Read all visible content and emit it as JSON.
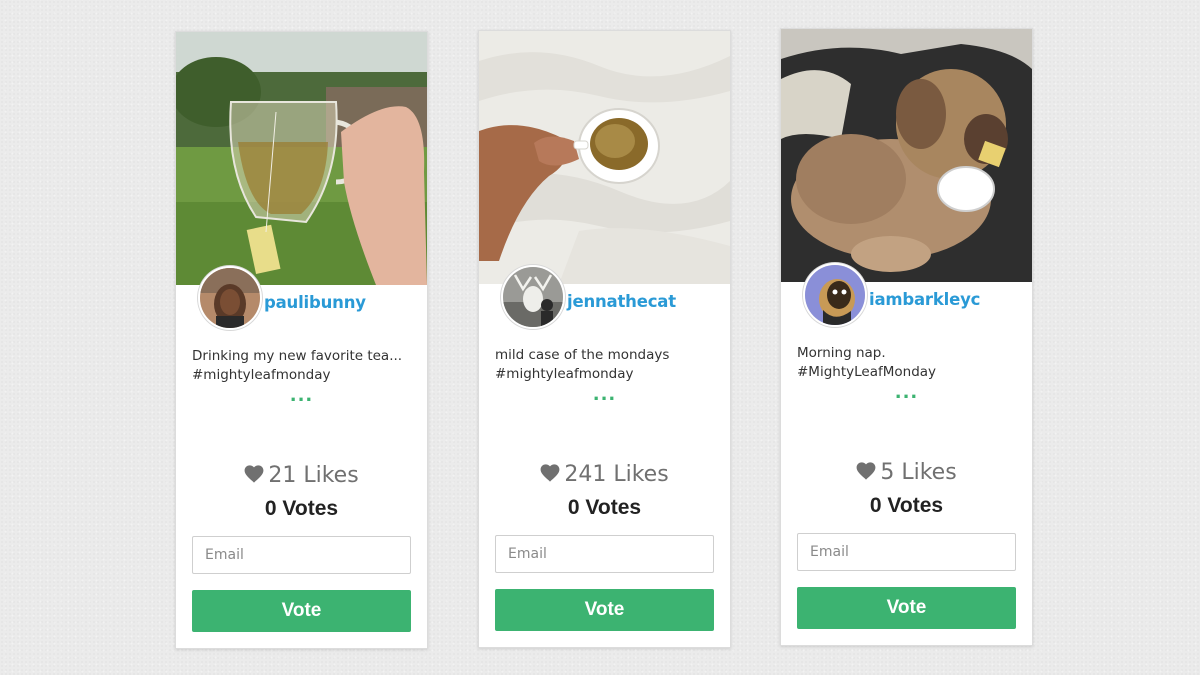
{
  "colors": {
    "accent_green": "#3cb371",
    "username_blue": "#2a9ad6",
    "likes_gray": "#707070",
    "page_background": "#ebebeb"
  },
  "cards": [
    {
      "username": "paulibunny",
      "caption_line1": "Drinking my new favorite tea...",
      "caption_line2": "#mightyleafmonday",
      "more": "...",
      "likes": "21 Likes",
      "votes": "0 Votes",
      "email_placeholder": "Email",
      "vote_label": "Vote",
      "heart_icon": "heart-icon"
    },
    {
      "username": "jennathecat",
      "caption_line1": "mild case of the mondays",
      "caption_line2": "#mightyleafmonday",
      "more": "...",
      "likes": "241 Likes",
      "votes": "0 Votes",
      "email_placeholder": "Email",
      "vote_label": "Vote",
      "heart_icon": "heart-icon"
    },
    {
      "username": "iambarkleyc",
      "caption_line1": "Morning nap.",
      "caption_line2": "#MightyLeafMonday",
      "more": "...",
      "likes": "5 Likes",
      "votes": "0 Votes",
      "email_placeholder": "Email",
      "vote_label": "Vote",
      "heart_icon": "heart-icon"
    }
  ]
}
